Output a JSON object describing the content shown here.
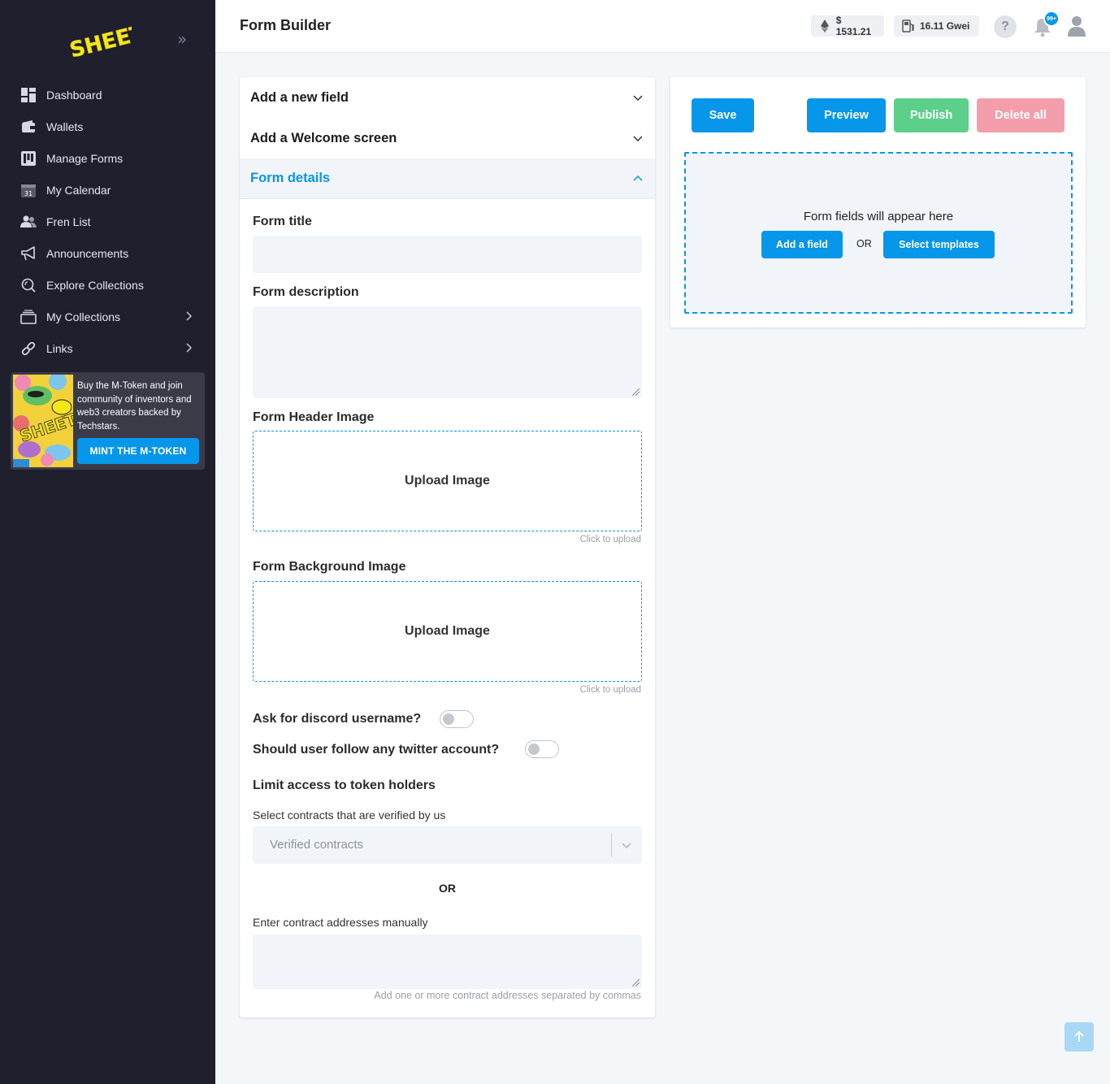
{
  "app": {
    "logo_text": "SHEETY",
    "page_title": "Form Builder"
  },
  "header": {
    "eth_price": "$ 1531.21",
    "gas_price": "16.11 Gwei",
    "help_symbol": "?",
    "notifications_badge": "99+"
  },
  "sidebar": {
    "items": [
      {
        "label": "Dashboard",
        "icon": "dashboard-icon"
      },
      {
        "label": "Wallets",
        "icon": "wallet-icon"
      },
      {
        "label": "Manage Forms",
        "icon": "forms-icon"
      },
      {
        "label": "My Calendar",
        "icon": "calendar-icon"
      },
      {
        "label": "Fren List",
        "icon": "users-icon"
      },
      {
        "label": "Announcements",
        "icon": "megaphone-icon"
      },
      {
        "label": "Explore Collections",
        "icon": "explore-icon"
      },
      {
        "label": "My Collections",
        "icon": "collections-icon"
      },
      {
        "label": "Links",
        "icon": "link-icon"
      }
    ],
    "calendar_day": "31",
    "promo": {
      "text": "Buy the M-Token and join community of inventors and web3 creators backed by Techstars.",
      "button": "MINT THE M-TOKEN"
    }
  },
  "left_panel": {
    "accordions": [
      "Add a new field",
      "Add a Welcome screen",
      "Form details"
    ],
    "form_title_label": "Form title",
    "form_description_label": "Form description",
    "header_image_label": "Form Header Image",
    "background_image_label": "Form Background Image",
    "upload_text": "Upload Image",
    "upload_hint": "Click to upload",
    "discord_label": "Ask for discord username?",
    "twitter_label": "Should user follow any twitter account?",
    "limit_access_label": "Limit access to token holders",
    "verified_label": "Select contracts that are verified by us",
    "verified_placeholder": "Verified contracts",
    "or_text": "OR",
    "manual_label": "Enter contract addresses manually",
    "manual_hint": "Add one or more contract addresses separated by commas"
  },
  "right_panel": {
    "save": "Save",
    "preview": "Preview",
    "publish": "Publish",
    "delete_all": "Delete all",
    "empty_text": "Form fields will appear here",
    "add_field": "Add a field",
    "or_text": "OR",
    "select_templates": "Select templates"
  },
  "colors": {
    "accent": "#0696ea",
    "publish": "#5cd08a",
    "delete": "#f59eab",
    "sidebar_bg": "#1f1f2e",
    "logo_yellow": "#f5e61a"
  }
}
